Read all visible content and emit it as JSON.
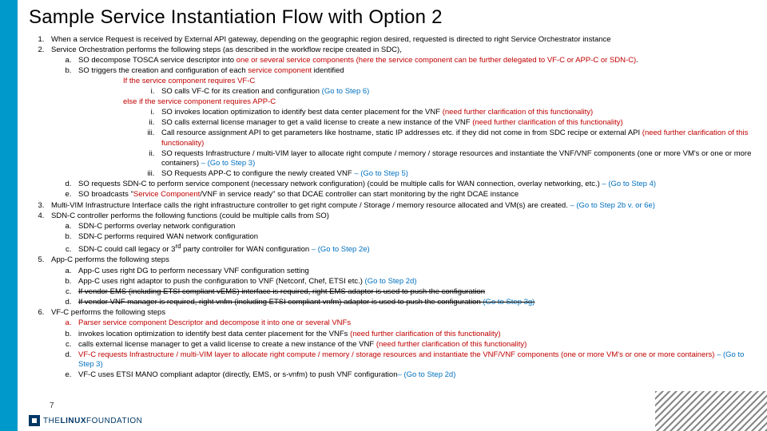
{
  "title": "Sample Service Instantiation Flow with Option 2",
  "pageNumber": "7",
  "logo": {
    "the": "THE",
    "linux": "LINUX",
    "foundation": "FOUNDATION"
  },
  "t": {
    "l1": "When a service Request is received by External API gateway, depending on the geographic region desired, requested is directed to right Service Orchestrator instance",
    "l2": "Service Orchestration performs the following steps (as described in the workflow recipe created in SDC),",
    "l2a_a": "SO decompose TOSCA service descriptor into ",
    "l2a_b": "one or several service components (here the service component can be further delegated to VF-C or APP-C or SDN-C)",
    "l2a_c": ".",
    "l2b_a": "SO triggers the creation and configuration of each ",
    "l2b_b": "service component",
    "l2b_c": " identified",
    "cond1": "If the service component requires VF-C",
    "cond1_i_a": "SO calls VF-C for its creation and configuration ",
    "cond1_i_b": "(Go to Step 6)",
    "cond2": "else if the service component requires APP-C",
    "c2_i_a": "SO invokes location optimization to identify best data center placement for the VNF ",
    "c2_i_b": "(need further clarification of this functionality)",
    "c2_ii_a": "SO calls external license manager to get a valid license to create a new instance of the VNF ",
    "c2_ii_b": "(need further clarification of this functionality)",
    "c2_iii_a": "Call resource assignment API to get parameters like hostname, static IP addresses etc. if they did not come in from SDC recipe or external API ",
    "c2_iii_b": "(need further clarification of this functionality)",
    "c2_ii2_a": "SO requests Infrastructure / multi-VIM layer to allocate right compute / memory / storage resources and instantiate the VNF/VNF components (one or more VM's or one or more containers) ",
    "c2_ii2_b": "– (Go to Step 3)",
    "c2_iii2_a": "SO Requests APP-C to configure the newly created VNF ",
    "c2_iii2_b": "– (Go to Step 5)",
    "l2d_a": "SO requests SDN-C to perform service component (necessary network configuration) (could be multiple calls for WAN connection, overlay networking, etc.) ",
    "l2d_b": "– (Go to Step 4)",
    "l2e_a": "SO broadcasts \"",
    "l2e_b": "Service Component",
    "l2e_c": "/VNF in service ready\" so that DCAE controller can start monitoring by the right DCAE instance",
    "l3_a": "Multi-VIM Infrastructure Interface calls the right infrastructure controller to get right compute / Storage / memory resource allocated and VM(s) are created. ",
    "l3_b": "– (Go to Step 2b v. or 6e)",
    "l4": "SDN-C controller performs the following functions (could be multiple calls from SO)",
    "l4a": "SDN-C performs overlay network configuration",
    "l4b": "SDN-C performs required WAN network configuration",
    "l4c_a": "SDN-C could call legacy or 3",
    "l4c_sup": "rd",
    "l4c_b": " party controller for WAN configuration ",
    "l4c_c": "– (Go to Step 2e)",
    "l5": "App-C performs the following steps",
    "l5a": "App-C uses right DG to perform necessary VNF configuration setting",
    "l5b_a": "App-C uses right adaptor to push the configuration to VNF (Netconf, Chef, ETSI etc.) ",
    "l5b_b": "(Go to Step 2d)",
    "l5c": "If vendor EMS (including ETSI compliant vEMS) interface is required, right EMS adaptor is used to push the configuration",
    "l5d_a": "If vendor VNF manager is required, right vnfm (including ETSI compliant vnfm) adaptor is used to push the configuration  ",
    "l5d_b": "(Go to Step 3g)",
    "l6": "VF-C performs the following steps",
    "l6a": "Parser service component Descriptor and decompose it into one or several VNFs",
    "l6b_a": "invokes location optimization to identify best data center placement for the VNFs ",
    "l6b_b": "(need further clarification of this functionality)",
    "l6c_a": "calls external license manager to get a valid license to create a new instance of the VNF ",
    "l6c_b": "(need further clarification of this functionality)",
    "l6d_a": "VF-C requests Infrastructure / multi-VIM layer to allocate right compute / memory / storage resources and instantiate the VNF/VNF components (one or more VM's or one or more containers) ",
    "l6d_b": "– (Go to Step 3)",
    "l6e_a": "VF-C uses ETSI MANO compliant adaptor (directly, EMS, or s-vnfm) to push VNF configuration",
    "l6e_b": "– (Go to Step 2d)"
  }
}
